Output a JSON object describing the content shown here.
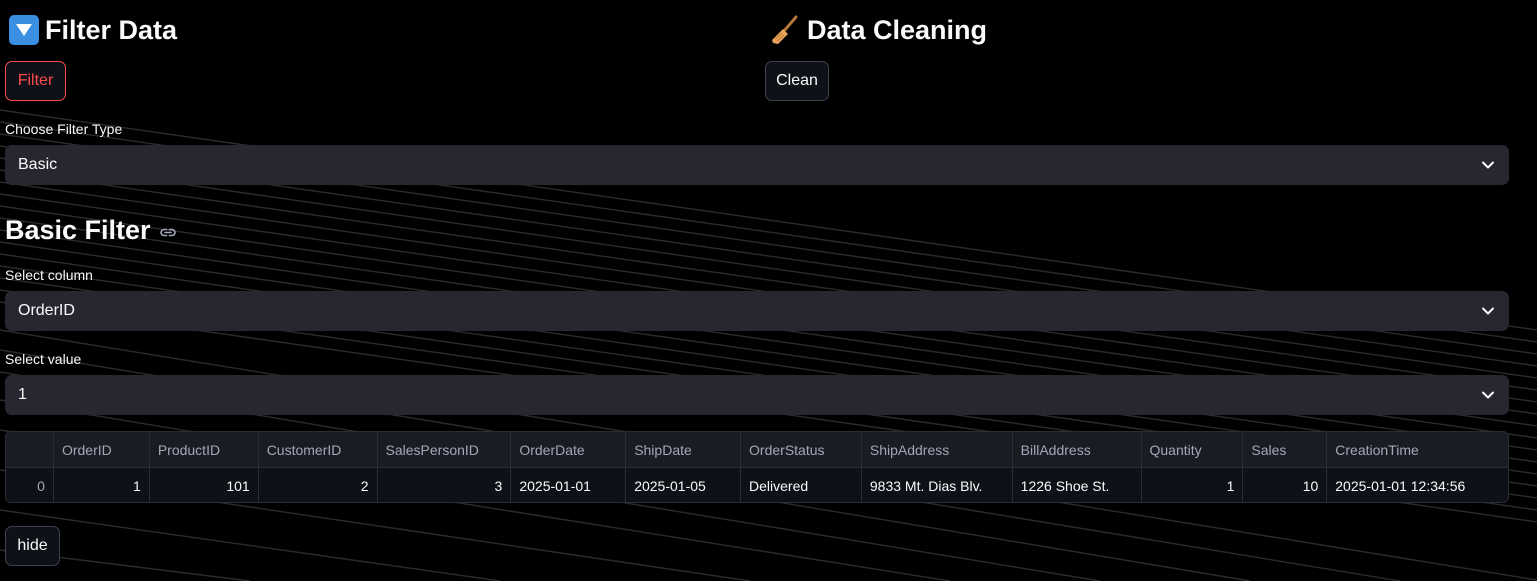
{
  "left": {
    "title": "Filter Data",
    "filter_button": "Filter",
    "filter_type_label": "Choose Filter Type",
    "filter_type_value": "Basic",
    "section_title": "Basic Filter",
    "column_label": "Select column",
    "column_value": "OrderID",
    "value_label": "Select value",
    "value_value": "1",
    "hide_button": "hide"
  },
  "right": {
    "title": "Data Cleaning",
    "clean_button": "Clean"
  },
  "icons": {
    "filter_icon": "down-triangle-emoji",
    "cleaning_icon": "broom-emoji",
    "anchor_icon": "link-icon",
    "dropdown_icon": "chevron-down-icon"
  },
  "table": {
    "columns": [
      "",
      "OrderID",
      "ProductID",
      "CustomerID",
      "SalesPersonID",
      "OrderDate",
      "ShipDate",
      "OrderStatus",
      "ShipAddress",
      "BillAddress",
      "Quantity",
      "Sales",
      "CreationTime"
    ],
    "rows": [
      [
        "0",
        "1",
        "101",
        "2",
        "3",
        "2025-01-01",
        "2025-01-05",
        "Delivered",
        "9833 Mt. Dias Blv.",
        "1226 Shoe St.",
        "1",
        "10",
        "2025-01-01 12:34:56"
      ]
    ]
  },
  "colors": {
    "accent": "#ff4b4b",
    "background": "#000000",
    "widget": "#262730"
  }
}
